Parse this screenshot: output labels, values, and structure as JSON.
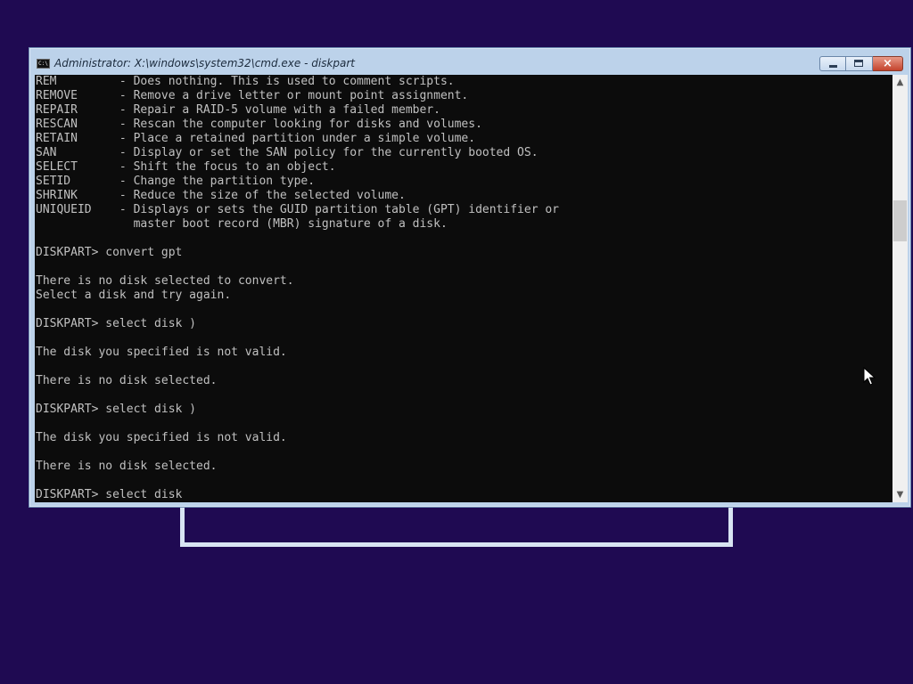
{
  "window": {
    "title": "Administrator: X:\\windows\\system32\\cmd.exe - diskpart",
    "icon_label": "C:\\",
    "buttons": {
      "minimize": "minimize-icon",
      "maximize": "maximize-icon",
      "close": "×"
    }
  },
  "console": {
    "lines": [
      "REM         - Does nothing. This is used to comment scripts.",
      "REMOVE      - Remove a drive letter or mount point assignment.",
      "REPAIR      - Repair a RAID-5 volume with a failed member.",
      "RESCAN      - Rescan the computer looking for disks and volumes.",
      "RETAIN      - Place a retained partition under a simple volume.",
      "SAN         - Display or set the SAN policy for the currently booted OS.",
      "SELECT      - Shift the focus to an object.",
      "SETID       - Change the partition type.",
      "SHRINK      - Reduce the size of the selected volume.",
      "UNIQUEID    - Displays or sets the GUID partition table (GPT) identifier or",
      "              master boot record (MBR) signature of a disk.",
      "",
      "DISKPART> convert gpt",
      "",
      "There is no disk selected to convert.",
      "Select a disk and try again.",
      "",
      "DISKPART> select disk )",
      "",
      "The disk you specified is not valid.",
      "",
      "There is no disk selected.",
      "",
      "DISKPART> select disk )",
      "",
      "The disk you specified is not valid.",
      "",
      "There is no disk selected.",
      "",
      "DISKPART> select disk"
    ]
  },
  "scrollbar": {
    "up_arrow": "▲",
    "down_arrow": "▼",
    "position_fraction": 0.31
  },
  "colors": {
    "desktop": "#1f0a52",
    "console_bg": "#0c0c0c",
    "console_text": "#c0c0c0",
    "close_button": "#c4432d"
  }
}
